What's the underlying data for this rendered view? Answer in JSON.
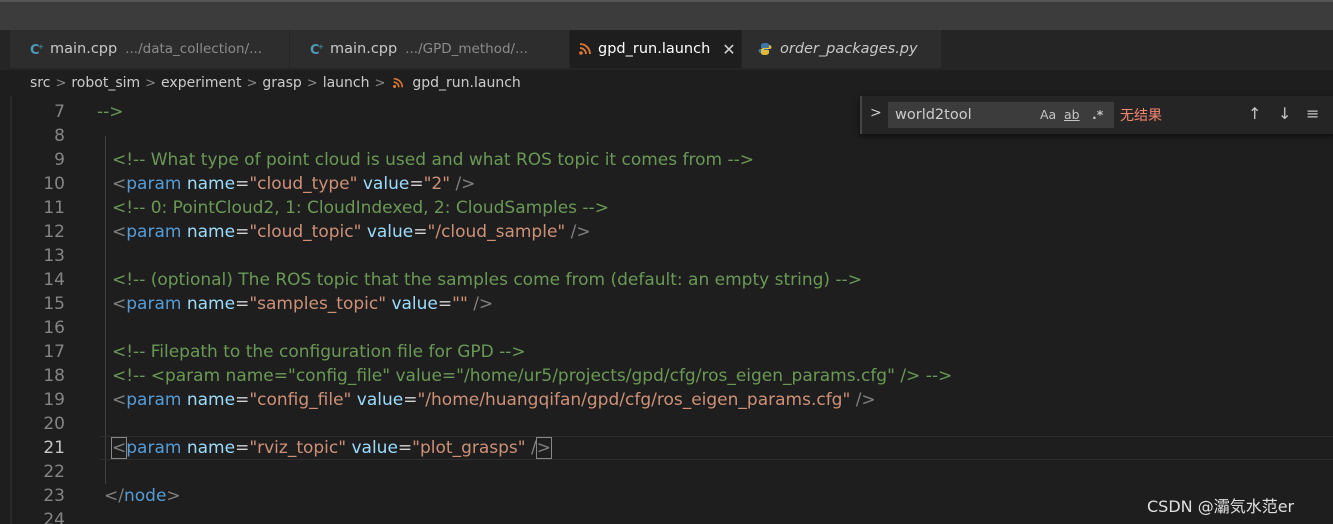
{
  "tabs": [
    {
      "name": "main.cpp",
      "desc": ".../data_collection/...",
      "icon": "cpp-icon",
      "active": false
    },
    {
      "name": "main.cpp",
      "desc": ".../GPD_method/...",
      "icon": "cpp-icon",
      "active": false
    },
    {
      "name": "gpd_run.launch",
      "desc": "",
      "icon": "rss-icon",
      "active": true,
      "close": "✕"
    },
    {
      "name": "order_packages.py",
      "desc": "",
      "icon": "python-icon",
      "active": false
    }
  ],
  "breadcrumb": [
    "src",
    "robot_sim",
    "experiment",
    "grasp",
    "launch",
    "gpd_run.launch"
  ],
  "find": {
    "query": "world2tool",
    "match_case": "Aa",
    "whole_word": "ab",
    "regex": ".*",
    "result": "无结果",
    "prev": "↑",
    "next": "↓",
    "menu": "≡",
    "toggle": ">"
  },
  "lines": [
    {
      "n": "7",
      "text": "-->"
    },
    {
      "n": "8",
      "text": ""
    },
    {
      "n": "9",
      "text": "<!-- What type of point cloud is used and what ROS topic it comes from -->"
    },
    {
      "n": "10",
      "text": "<param name=\"cloud_type\" value=\"2\" />"
    },
    {
      "n": "11",
      "text": "<!-- 0: PointCloud2, 1: CloudIndexed, 2: CloudSamples -->"
    },
    {
      "n": "12",
      "text": "<param name=\"cloud_topic\" value=\"/cloud_sample\" />"
    },
    {
      "n": "13",
      "text": ""
    },
    {
      "n": "14",
      "text": "<!-- (optional) The ROS topic that the samples come from (default: an empty string) -->"
    },
    {
      "n": "15",
      "text": "<param name=\"samples_topic\" value=\"\" />"
    },
    {
      "n": "16",
      "text": ""
    },
    {
      "n": "17",
      "text": "<!-- Filepath to the configuration file for GPD -->"
    },
    {
      "n": "18",
      "text": "<!-- <param name=\"config_file\" value=\"/home/ur5/projects/gpd/cfg/ros_eigen_params.cfg\" /> -->"
    },
    {
      "n": "19",
      "text": "<param name=\"config_file\" value=\"/home/huangqifan/gpd/cfg/ros_eigen_params.cfg\" />"
    },
    {
      "n": "20",
      "text": ""
    },
    {
      "n": "21",
      "text": "<param name=\"rviz_topic\" value=\"plot_grasps\" />"
    },
    {
      "n": "22",
      "text": ""
    },
    {
      "n": "23",
      "text": "</node>"
    },
    {
      "n": "24",
      "text": ""
    }
  ],
  "watermark": "CSDN @灞気水范er",
  "colors": {
    "comment": "#6a9955",
    "tag": "#569cd6",
    "attr": "#9cdcfe",
    "string": "#ce9178",
    "no_result": "#f48771"
  }
}
